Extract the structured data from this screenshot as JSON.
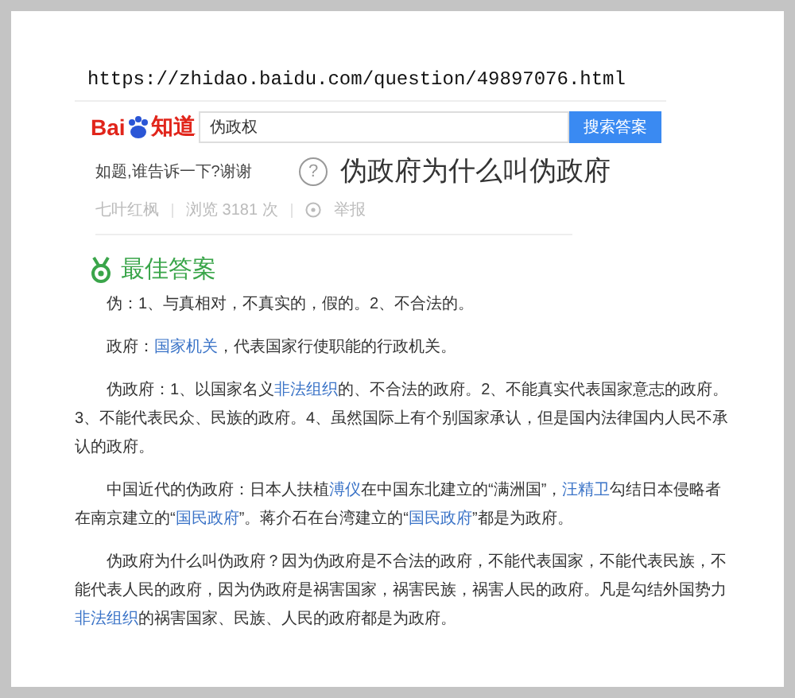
{
  "url": "https://zhidao.baidu.com/question/49897076.html",
  "header": {
    "logo": {
      "left": "Bai",
      "right": "知道"
    },
    "search": {
      "value": "伪政权"
    },
    "search_button": "搜索答案"
  },
  "question": {
    "icon": "?",
    "title": "伪政府为什么叫伪政府",
    "description": "如题,谁告诉一下?谢谢",
    "meta": {
      "author": "七叶红枫",
      "views": "浏览 3181 次",
      "report": "举报"
    }
  },
  "best_answer": {
    "heading": "最佳答案",
    "paragraphs": [
      [
        {
          "text": "伪：1、与真相对，不真实的，假的。2、不合法的。",
          "link": false
        }
      ],
      [
        {
          "text": "政府：",
          "link": false
        },
        {
          "text": "国家机关",
          "link": true
        },
        {
          "text": "，代表国家行使职能的行政机关。",
          "link": false
        }
      ],
      [
        {
          "text": "伪政府：1、以国家名义",
          "link": false
        },
        {
          "text": "非法组织",
          "link": true
        },
        {
          "text": "的、不合法的政府。2、不能真实代表国家意志的政府。3、不能代表民众、民族的政府。4、虽然国际上有个别国家承认，但是国内法律国内人民不承认的政府。",
          "link": false
        }
      ],
      [
        {
          "text": "中国近代的伪政府：日本人扶植",
          "link": false
        },
        {
          "text": "溥仪",
          "link": true
        },
        {
          "text": "在中国东北建立的“满洲国”，",
          "link": false
        },
        {
          "text": "汪精卫",
          "link": true
        },
        {
          "text": "勾结日本侵略者在南京建立的“",
          "link": false
        },
        {
          "text": "国民政府",
          "link": true
        },
        {
          "text": "”。蒋介石在台湾建立的“",
          "link": false
        },
        {
          "text": "国民政府",
          "link": true
        },
        {
          "text": "”都是为政府。",
          "link": false
        }
      ],
      [
        {
          "text": "伪政府为什么叫伪政府？因为伪政府是不合法的政府，不能代表国家，不能代表民族，不能代表人民的政府，因为伪政府是祸害国家，祸害民族，祸害人民的政府。凡是勾结外国势力",
          "link": false
        },
        {
          "text": "非法组织",
          "link": true
        },
        {
          "text": "的祸害国家、民族、人民的政府都是为政府。",
          "link": false
        }
      ]
    ]
  }
}
